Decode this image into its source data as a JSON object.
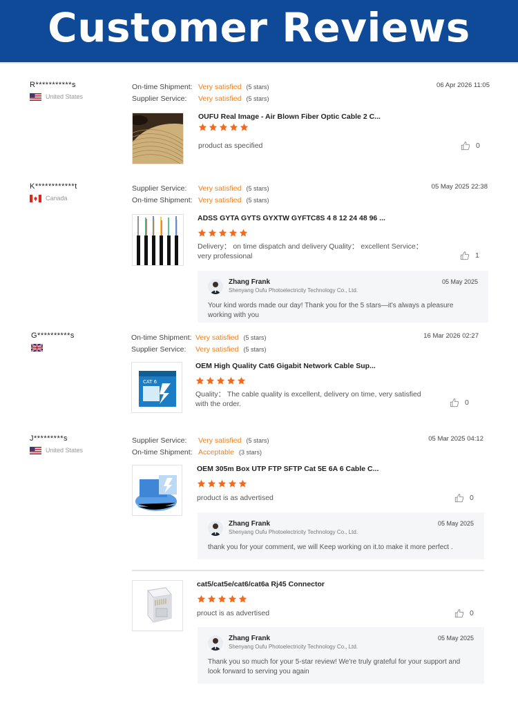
{
  "header": {
    "title": "Customer Reviews"
  },
  "colors": {
    "banner": "#0f4a98",
    "accent": "#f07f1c",
    "star": "#f26b1d"
  },
  "reviews": [
    {
      "reviewer": "R***********s",
      "country": "United States",
      "flag": "us-flag",
      "date": "06 Apr 2026 11:05",
      "ratings": [
        {
          "label": "On-time Shipment:",
          "value": "Very satisfied",
          "count": "(5 stars)"
        },
        {
          "label": "Supplier Service:",
          "value": "Very satisfied",
          "count": "(5 stars)"
        }
      ],
      "products": [
        {
          "title": "OUFU Real Image - Air Blown Fiber Optic Cable 2 C...",
          "stars": 5,
          "text": "product as specified",
          "likes": "0"
        }
      ]
    },
    {
      "reviewer": "K************t",
      "country": "Canada",
      "flag": "canada-flag",
      "date": "05 May 2025 22:38",
      "ratings": [
        {
          "label": "Supplier Service:",
          "value": "Very satisfied",
          "count": "(5 stars)"
        },
        {
          "label": "On-time Shipment:",
          "value": "Very satisfied",
          "count": "(5 stars)"
        }
      ],
      "products": [
        {
          "title": "ADSS GYTA GYTS GYXTW GYFTC8S 4 8 12 24 48 96 ...",
          "stars": 5,
          "text": "Delivery： on time dispatch and delivery Quality： excellent Service： very professional",
          "likes": "1",
          "reply": {
            "name": "Zhang Frank",
            "company": "Shenyang Oufu Photoelectricity Technology Co., Ltd.",
            "date": "05 May 2025",
            "text": "Your kind words made our day! Thank you for the 5 stars—it's always a pleasure working with you"
          }
        }
      ]
    },
    {
      "reviewer": "G**********s",
      "country": "",
      "flag": "uk-flag",
      "date": "16 Mar 2026 02:27",
      "ratings": [
        {
          "label": "On-time Shipment:",
          "value": "Very satisfied",
          "count": "(5 stars)"
        },
        {
          "label": "Supplier Service:",
          "value": "Very satisfied",
          "count": "(5 stars)"
        }
      ],
      "products": [
        {
          "title": "OEM High Quality Cat6 Gigabit Network Cable Sup...",
          "stars": 5,
          "text": "Quality： The cable quality is excellent, delivery on time, very satisfied with the order.",
          "likes": "0"
        }
      ]
    },
    {
      "reviewer": "J*********s",
      "country": "United States",
      "flag": "us-flag",
      "date": "05 Mar 2025 04:12",
      "ratings": [
        {
          "label": "Supplier Service:",
          "value": "Very satisfied",
          "count": "(5 stars)"
        },
        {
          "label": "On-time Shipment:",
          "value": "Acceptable",
          "count": "(3 stars)"
        }
      ],
      "products": [
        {
          "title": "OEM 305m Box UTP FTP SFTP Cat 5E 6A 6 Cable C...",
          "stars": 5,
          "text": "product is as advertised",
          "likes": "0",
          "reply": {
            "name": "Zhang Frank",
            "company": "Shenyang Oufu Photoelectricity Technology Co., Ltd.",
            "date": "05 May 2025",
            "text": "thank you for your comment, we will Keep working on it.to make it more perfect ."
          }
        },
        {
          "title": "cat5/cat5e/cat6/cat6a Rj45 Connector",
          "stars": 5,
          "text": "prouct is as advertised",
          "likes": "0",
          "reply": {
            "name": "Zhang Frank",
            "company": "Shenyang Oufu Photoelectricity Technology Co., Ltd.",
            "date": "05 May 2025",
            "text": "Thank you so much for your 5-star review! We're truly grateful for your support and look forward to serving you again"
          }
        }
      ]
    }
  ]
}
